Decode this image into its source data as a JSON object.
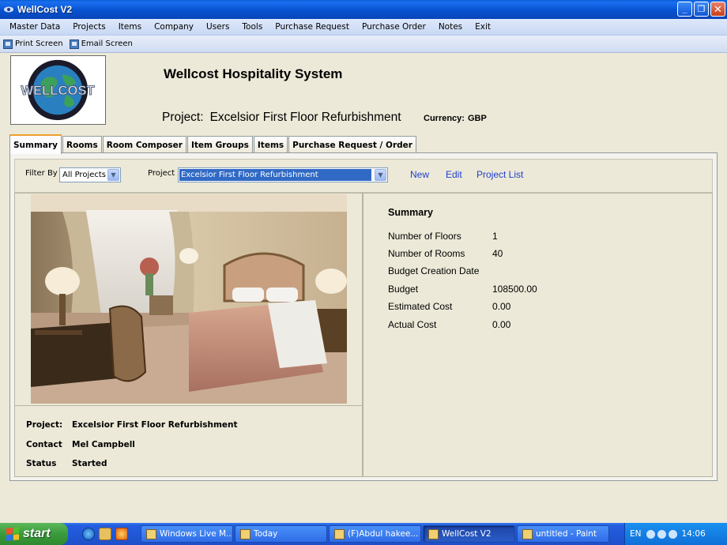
{
  "window": {
    "title": "WellCost V2",
    "buttons": [
      "_",
      "❐",
      "✕"
    ]
  },
  "menu": [
    "Master Data",
    "Projects",
    "Items",
    "Company",
    "Users",
    "Tools",
    "Purchase Request",
    "Purchase Order",
    "Notes",
    "Exit"
  ],
  "toolbar": {
    "print": "Print Screen",
    "email": "Email Screen"
  },
  "header": {
    "system_title": "Wellcost Hospitality System",
    "project_label": "Project:",
    "project_name": "Excelsior First Floor Refurbishment",
    "currency_label": "Currency:",
    "currency_value": "GBP",
    "logo_text": "WELLCOST"
  },
  "tabs": [
    "Summary",
    "Rooms",
    "Room Composer",
    "Item Groups",
    "Items",
    "Purchase Request / Order"
  ],
  "filter": {
    "filter_label": "Filter By",
    "filter_value": "All Projects",
    "project_label": "Project",
    "project_value": "Excelsior First Floor Refurbishment",
    "links": {
      "new": "New",
      "edit": "Edit",
      "list": "Project List"
    }
  },
  "details": {
    "project_key": "Project:",
    "project_val": "Excelsior First Floor Refurbishment",
    "contact_key": "Contact",
    "contact_val": "Mel Campbell",
    "status_key": "Status",
    "status_val": "Started"
  },
  "summary": {
    "title": "Summary",
    "rows": [
      {
        "k": "Number of Floors",
        "v": "1"
      },
      {
        "k": "Number of Rooms",
        "v": "40"
      },
      {
        "k": "Budget Creation Date",
        "v": ""
      },
      {
        "k": "Budget",
        "v": "108500.00"
      },
      {
        "k": "Estimated Cost",
        "v": "0.00"
      },
      {
        "k": "Actual Cost",
        "v": "0.00"
      }
    ]
  },
  "taskbar": {
    "start": "start",
    "tasks": [
      "Windows Live M...",
      "Today",
      "(F)Abdul hakee...",
      "WellCost V2",
      "untitled - Paint"
    ],
    "lang": "EN",
    "clock": "14:06"
  },
  "colors": {
    "titlebar": "#0a5fd8",
    "link": "#1f3fcf",
    "selection": "#316ac5",
    "tab_accent": "#f0a030"
  }
}
